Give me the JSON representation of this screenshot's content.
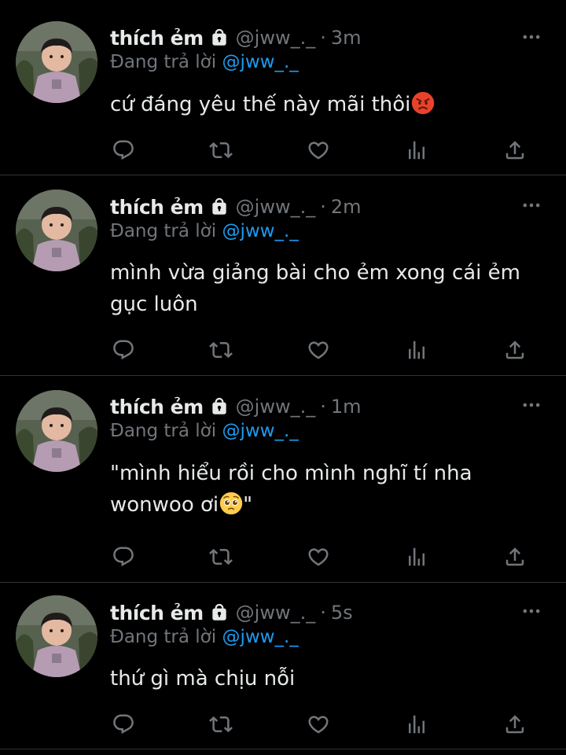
{
  "tweets": [
    {
      "name": "thích ẻm",
      "handle": "@jww_._",
      "separator": "·",
      "time": "3m",
      "reply_prefix": "Đang trả lời",
      "reply_to": "@jww_._",
      "lines": [
        "cứ đáng yêu thế này mãi thôi"
      ],
      "emoji": "angry-face"
    },
    {
      "name": "thích ẻm",
      "handle": "@jww_._",
      "separator": "·",
      "time": "2m",
      "reply_prefix": "Đang trả lời",
      "reply_to": "@jww_._",
      "lines": [
        "mình vừa giảng bài cho ẻm xong cái ẻm",
        "gục luôn"
      ]
    },
    {
      "name": "thích ẻm",
      "handle": "@jww_._",
      "separator": "·",
      "time": "1m",
      "reply_prefix": "Đang trả lời",
      "reply_to": "@jww_._",
      "lines": [
        "\"mình hiểu rồi cho mình nghĩ tí nha",
        "wonwoo ơi"
      ],
      "line2_suffix": "\"",
      "emoji": "pleading-face"
    },
    {
      "name": "thích ẻm",
      "handle": "@jww_._",
      "separator": "·",
      "time": "5s",
      "reply_prefix": "Đang trả lời",
      "reply_to": "@jww_._",
      "lines": [
        "thứ gì mà chịu nỗi"
      ]
    }
  ],
  "icons": {
    "lock": "lock-icon",
    "more": "more-icon",
    "reply": "reply-icon",
    "retweet": "retweet-icon",
    "like": "heart-icon",
    "views": "views-icon",
    "share": "share-icon"
  },
  "colors": {
    "background": "#000000",
    "text": "#e7e9ea",
    "secondary": "#71767b",
    "mention": "#1d9bf0",
    "divider": "#2f3336"
  }
}
